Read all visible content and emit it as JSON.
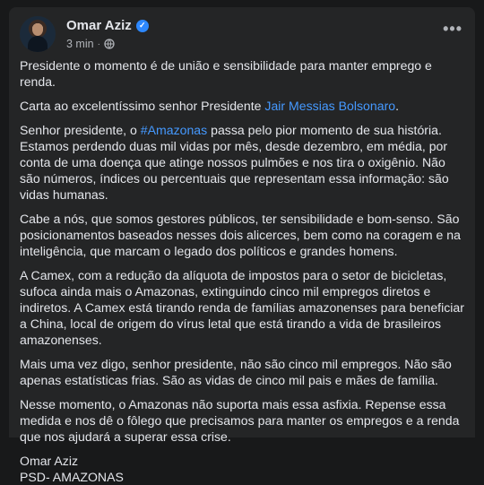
{
  "post": {
    "author": "Omar Aziz",
    "timestamp": "3 min",
    "separator": "·",
    "more_label": "•••",
    "paragraphs": {
      "p1": "Presidente o momento é de união e sensibilidade para manter emprego e renda.",
      "p2_prefix": "Carta ao excelentíssimo senhor Presidente ",
      "p2_link": "Jair Messias Bolsonaro",
      "p2_suffix": ".",
      "p3_prefix": "Senhor presidente, o ",
      "p3_hashtag": "#Amazonas",
      "p3_suffix": " passa pelo pior momento de sua história. Estamos perdendo duas mil vidas por mês, desde dezembro, em média, por conta de uma doença que atinge nossos pulmões e nos tira o oxigênio. Não são números, índices ou percentuais que representam essa informação: são vidas humanas.",
      "p4": "Cabe a nós, que somos gestores públicos, ter sensibilidade e bom-senso. São posicionamentos baseados nesses dois alicerces, bem como na coragem e na inteligência, que marcam o legado dos políticos e grandes homens.",
      "p5": "A Camex, com a redução da alíquota de impostos para o setor de bicicletas, sufoca ainda mais o Amazonas, extinguindo cinco mil empregos diretos e indiretos. A Camex está tirando renda de famílias amazonenses para beneficiar a China, local de origem do vírus letal que está tirando a vida de brasileiros amazonenses.",
      "p6": "Mais uma vez digo, senhor presidente, não são cinco mil empregos. Não são apenas estatísticas frias. São as vidas de cinco mil pais e mães de família.",
      "p7": "Nesse momento, o Amazonas não suporta mais essa asfixia. Repense essa medida e nos dê o fôlego que precisamos para manter os empregos e a renda que nos ajudará a superar essa crise.",
      "sig_name": "Omar Aziz",
      "sig_party": "PSD- AMAZONAS"
    }
  },
  "colors": {
    "background": "#18191a",
    "card": "#242526",
    "text": "#e4e6eb",
    "secondary": "#b0b3b8",
    "link": "#4599ff",
    "verified": "#2d88ff"
  },
  "icons": {
    "verified": "verified-badge-icon",
    "privacy": "globe-icon",
    "menu": "more-options-icon"
  }
}
